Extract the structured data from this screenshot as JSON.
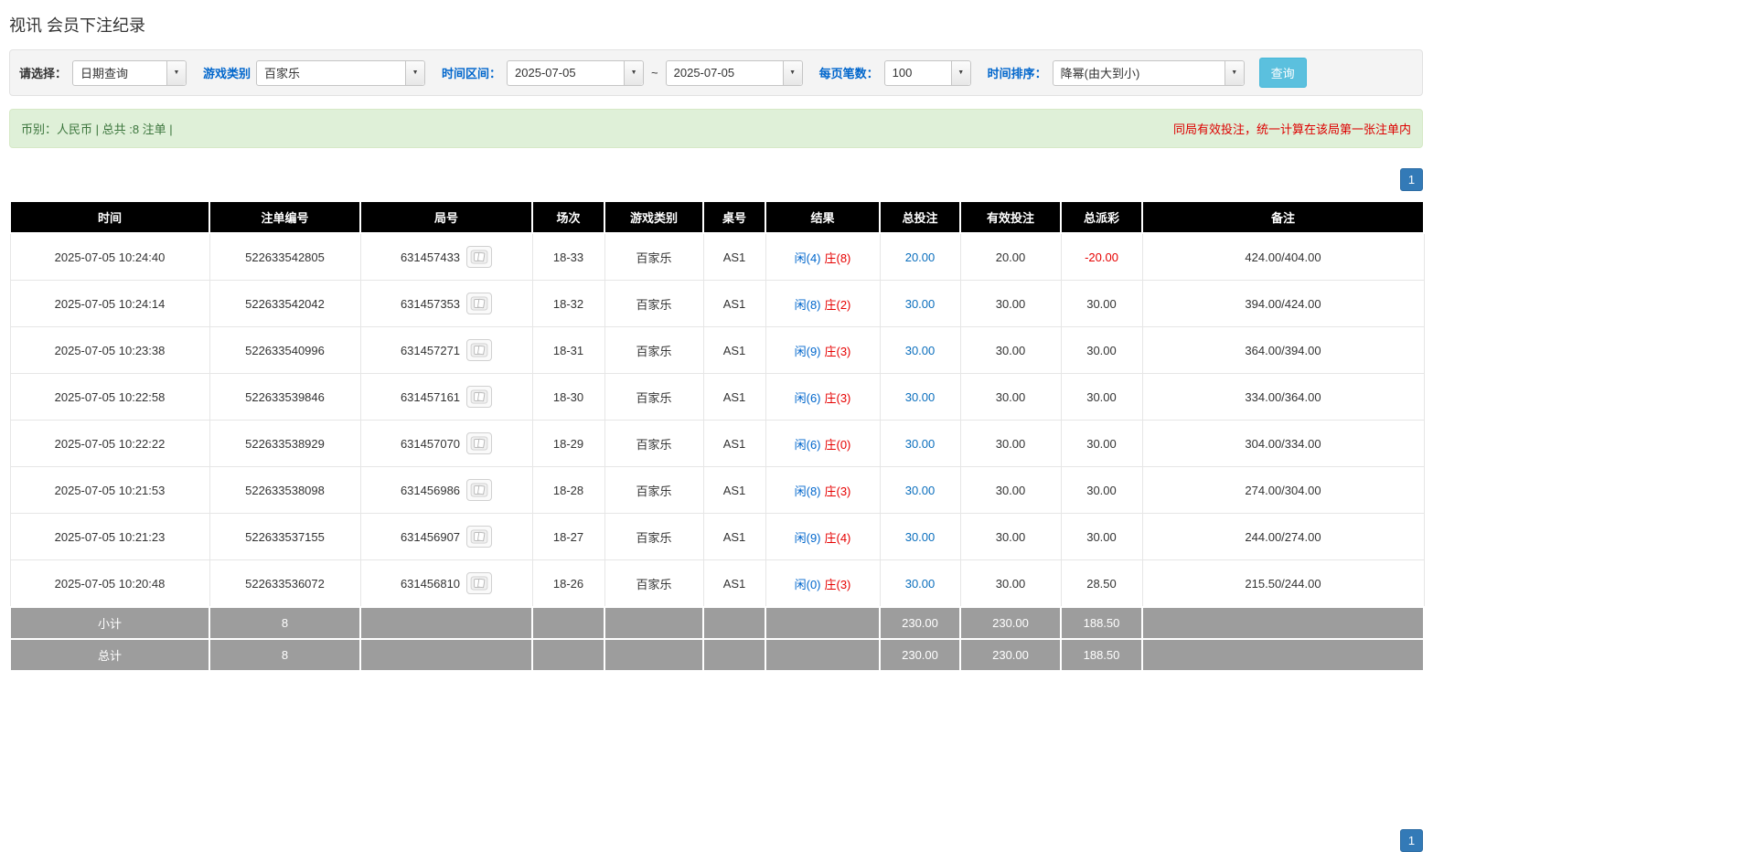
{
  "page": {
    "title": "视讯 会员下注纪录"
  },
  "icons": {
    "dropdown_arrow": "▼"
  },
  "filters": {
    "select_label": "请选择：",
    "select_value": "日期查询",
    "game_type_label": "游戏类别",
    "game_type_value": "百家乐",
    "time_range_label": "时间区间：",
    "date_from": "2025-07-05",
    "range_separator": "~",
    "date_to": "2025-07-05",
    "page_size_label": "每页笔数：",
    "page_size_value": "100",
    "sort_label": "时间排序：",
    "sort_value": "降幂(由大到小)",
    "search_button_label": "查询"
  },
  "summary": {
    "left_text": "币别：人民币 | 总共 :8 注单 |",
    "right_note": "同局有效投注，统一计算在该局第一张注单内"
  },
  "pagination": {
    "current_page": "1"
  },
  "table": {
    "headers": [
      "时间",
      "注单编号",
      "局号",
      "场次",
      "游戏类别",
      "桌号",
      "结果",
      "总投注",
      "有效投注",
      "总派彩",
      "备注"
    ],
    "rows": [
      {
        "time": "2025-07-05 10:24:40",
        "bet_id": "522633542805",
        "round_id": "631457433",
        "session": "18-33",
        "game": "百家乐",
        "table_no": "AS1",
        "result_player": "闲(4)",
        "result_banker": "庄(8)",
        "total_bet": "20.00",
        "valid_bet": "20.00",
        "payout": "-20.00",
        "remark": "424.00/404.00"
      },
      {
        "time": "2025-07-05 10:24:14",
        "bet_id": "522633542042",
        "round_id": "631457353",
        "session": "18-32",
        "game": "百家乐",
        "table_no": "AS1",
        "result_player": "闲(8)",
        "result_banker": "庄(2)",
        "total_bet": "30.00",
        "valid_bet": "30.00",
        "payout": "30.00",
        "remark": "394.00/424.00"
      },
      {
        "time": "2025-07-05 10:23:38",
        "bet_id": "522633540996",
        "round_id": "631457271",
        "session": "18-31",
        "game": "百家乐",
        "table_no": "AS1",
        "result_player": "闲(9)",
        "result_banker": "庄(3)",
        "total_bet": "30.00",
        "valid_bet": "30.00",
        "payout": "30.00",
        "remark": "364.00/394.00"
      },
      {
        "time": "2025-07-05 10:22:58",
        "bet_id": "522633539846",
        "round_id": "631457161",
        "session": "18-30",
        "game": "百家乐",
        "table_no": "AS1",
        "result_player": "闲(6)",
        "result_banker": "庄(3)",
        "total_bet": "30.00",
        "valid_bet": "30.00",
        "payout": "30.00",
        "remark": "334.00/364.00"
      },
      {
        "time": "2025-07-05 10:22:22",
        "bet_id": "522633538929",
        "round_id": "631457070",
        "session": "18-29",
        "game": "百家乐",
        "table_no": "AS1",
        "result_player": "闲(6)",
        "result_banker": "庄(0)",
        "total_bet": "30.00",
        "valid_bet": "30.00",
        "payout": "30.00",
        "remark": "304.00/334.00"
      },
      {
        "time": "2025-07-05 10:21:53",
        "bet_id": "522633538098",
        "round_id": "631456986",
        "session": "18-28",
        "game": "百家乐",
        "table_no": "AS1",
        "result_player": "闲(8)",
        "result_banker": "庄(3)",
        "total_bet": "30.00",
        "valid_bet": "30.00",
        "payout": "30.00",
        "remark": "274.00/304.00"
      },
      {
        "time": "2025-07-05 10:21:23",
        "bet_id": "522633537155",
        "round_id": "631456907",
        "session": "18-27",
        "game": "百家乐",
        "table_no": "AS1",
        "result_player": "闲(9)",
        "result_banker": "庄(4)",
        "total_bet": "30.00",
        "valid_bet": "30.00",
        "payout": "30.00",
        "remark": "244.00/274.00"
      },
      {
        "time": "2025-07-05 10:20:48",
        "bet_id": "522633536072",
        "round_id": "631456810",
        "session": "18-26",
        "game": "百家乐",
        "table_no": "AS1",
        "result_player": "闲(0)",
        "result_banker": "庄(3)",
        "total_bet": "30.00",
        "valid_bet": "30.00",
        "payout": "28.50",
        "remark": "215.50/244.00"
      }
    ],
    "subtotal": {
      "label": "小计",
      "count": "8",
      "total_bet": "230.00",
      "valid_bet": "230.00",
      "payout": "188.50"
    },
    "total": {
      "label": "总计",
      "count": "8",
      "total_bet": "230.00",
      "valid_bet": "230.00",
      "payout": "188.50"
    }
  }
}
